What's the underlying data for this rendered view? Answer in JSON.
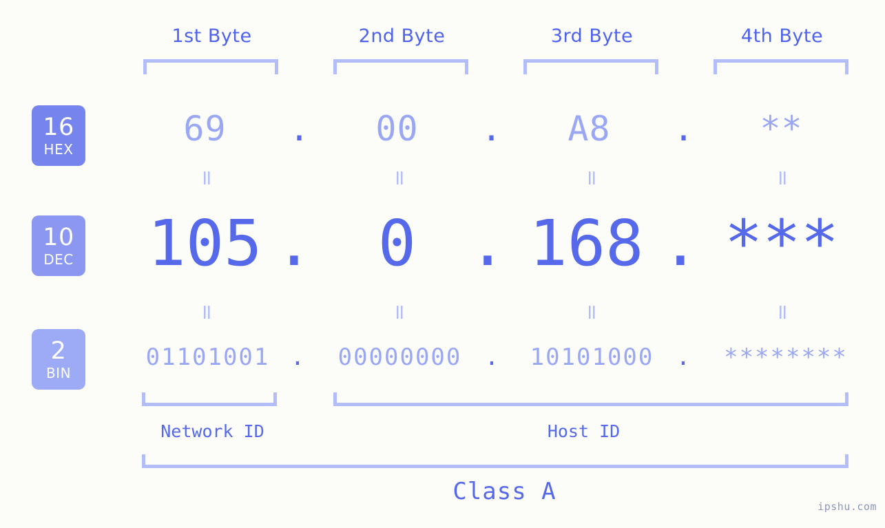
{
  "page": {
    "background_color": "#fcfdf9",
    "accent_color": "#5569ea",
    "muted_accent_color": "#9aa7f4",
    "bracket_color": "#b3bdf9",
    "watermark": "ipshu.com"
  },
  "headers": [
    {
      "label": "1st Byte"
    },
    {
      "label": "2nd Byte"
    },
    {
      "label": "3rd Byte"
    },
    {
      "label": "4th Byte"
    }
  ],
  "bases": [
    {
      "num": "16",
      "name": "HEX",
      "color": "#7685ee"
    },
    {
      "num": "10",
      "name": "DEC",
      "color": "#8b97f1"
    },
    {
      "num": "2",
      "name": "BIN",
      "color": "#9dabf6"
    }
  ],
  "rows": {
    "hex": {
      "values": [
        "69",
        "00",
        "A8",
        "**"
      ],
      "separator": "."
    },
    "dec": {
      "values": [
        "105",
        "0",
        "168",
        "***"
      ],
      "separator": "."
    },
    "bin": {
      "values": [
        "01101001",
        "00000000",
        "10101000",
        "********"
      ],
      "separator": "."
    }
  },
  "equals_mark": "=",
  "sections": {
    "network_id": "Network ID",
    "host_id": "Host ID",
    "class": "Class A"
  }
}
